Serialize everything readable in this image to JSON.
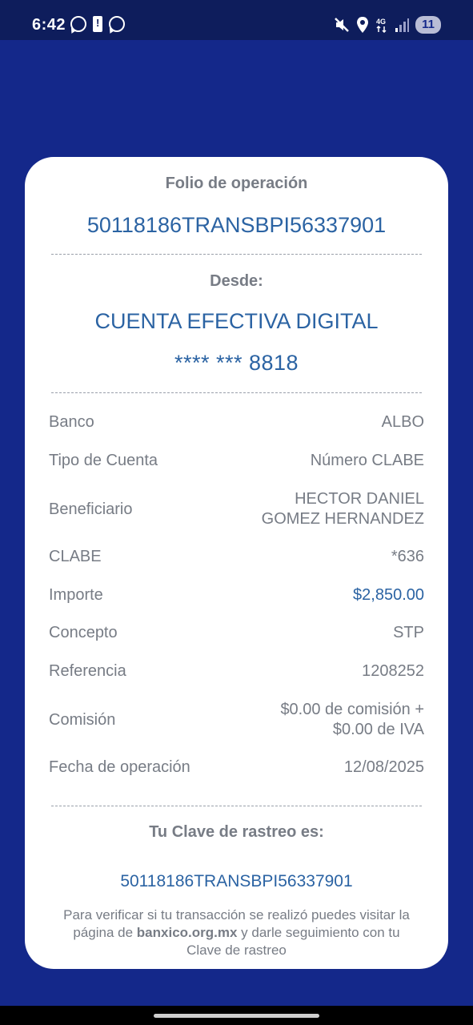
{
  "status_bar": {
    "time": "6:42",
    "notification_badge": "11"
  },
  "receipt": {
    "folio_label": "Folio de operación",
    "folio_value": "50118186TRANSBPI56337901",
    "from_label": "Desde:",
    "account_name": "CUENTA EFECTIVA DIGITAL",
    "account_number": "**** *** 8818",
    "details": [
      {
        "label": "Banco",
        "value": "ALBO"
      },
      {
        "label": "Tipo de Cuenta",
        "value": "Número CLABE"
      },
      {
        "label": "Beneficiario",
        "value_line1": "HECTOR DANIEL",
        "value_line2": "GOMEZ HERNANDEZ"
      },
      {
        "label": "CLABE",
        "value": "*636"
      },
      {
        "label": "Importe",
        "value": "$2,850.00"
      },
      {
        "label": "Concepto",
        "value": "STP"
      },
      {
        "label": "Referencia",
        "value": "1208252"
      },
      {
        "label": "Comisión",
        "value_line1": "$0.00 de comisión +",
        "value_line2": "$0.00 de IVA"
      },
      {
        "label": "Fecha de operación",
        "value": "12/08/2025"
      }
    ],
    "rastreo_label": "Tu Clave de rastreo es:",
    "rastreo_value": "50118186TRANSBPI56337901",
    "note_part1": "Para verificar si tu transacción se realizó puedes visitar la página de ",
    "note_link": "banxico.org.mx",
    "note_part2": " y darle seguimiento con tu Clave de rastreo"
  },
  "colors": {
    "background": "#14288a",
    "accent": "#2b63a3",
    "label": "#777c85"
  },
  "icons": [
    "whatsapp-icon",
    "battery-alert-icon",
    "mute-icon",
    "location-icon",
    "4g-icon",
    "signal-icon"
  ]
}
